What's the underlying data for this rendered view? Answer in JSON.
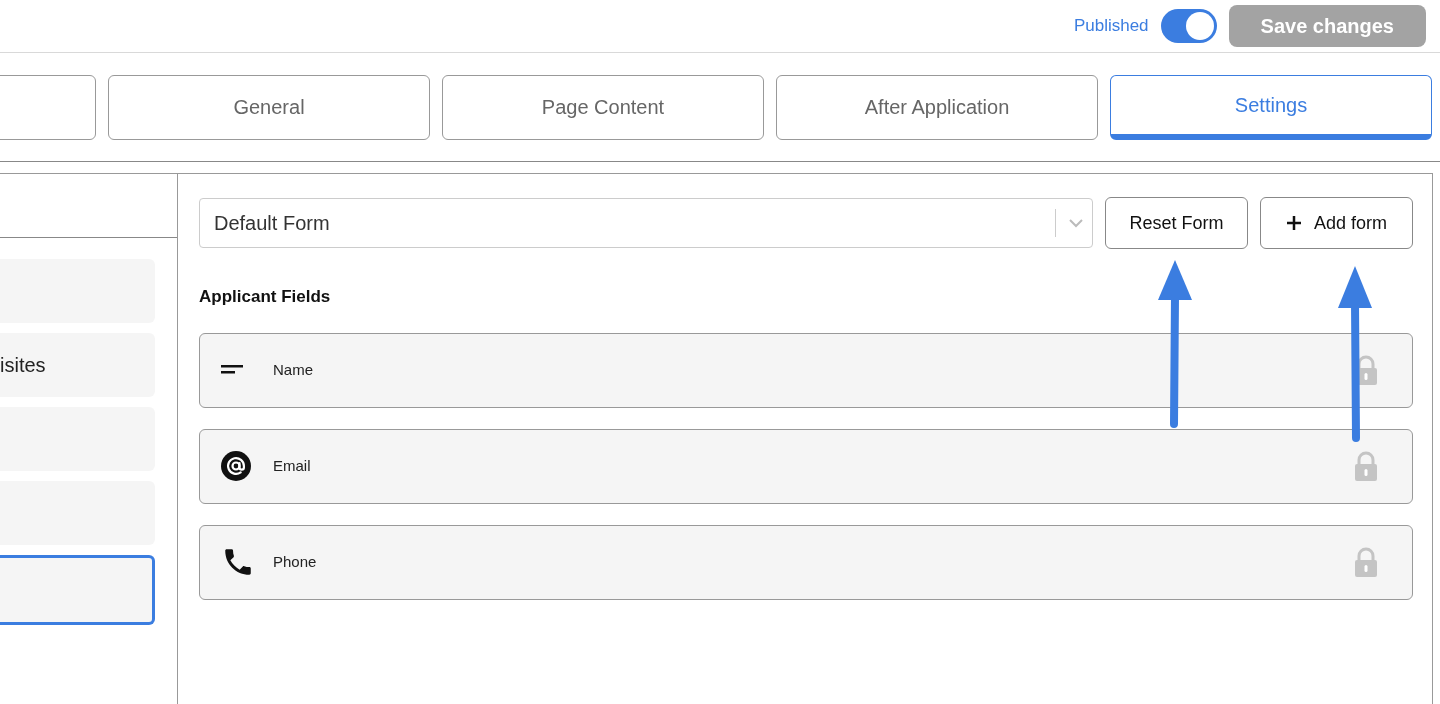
{
  "header": {
    "status_label": "Published",
    "published_on": true,
    "save_button": "Save changes"
  },
  "tabs": [
    {
      "selected": false
    },
    {
      "label": "General",
      "selected": false
    },
    {
      "label": "Page Content",
      "selected": false
    },
    {
      "label": "After Application",
      "selected": false
    },
    {
      "label": "Settings",
      "selected": true
    }
  ],
  "sidebar": {
    "items": [
      {
        "selected": false
      },
      {
        "label": "isites",
        "selected": false
      },
      {
        "selected": false
      },
      {
        "selected": false
      },
      {
        "selected": true
      }
    ]
  },
  "form": {
    "dropdown_value": "Default Form",
    "reset_button": "Reset Form",
    "add_button": "Add form",
    "section_title": "Applicant Fields",
    "fields": [
      {
        "kind": "text",
        "label": "Name",
        "locked": true
      },
      {
        "kind": "email",
        "label": "Email",
        "locked": true
      },
      {
        "kind": "phone",
        "label": "Phone",
        "locked": true
      }
    ]
  }
}
